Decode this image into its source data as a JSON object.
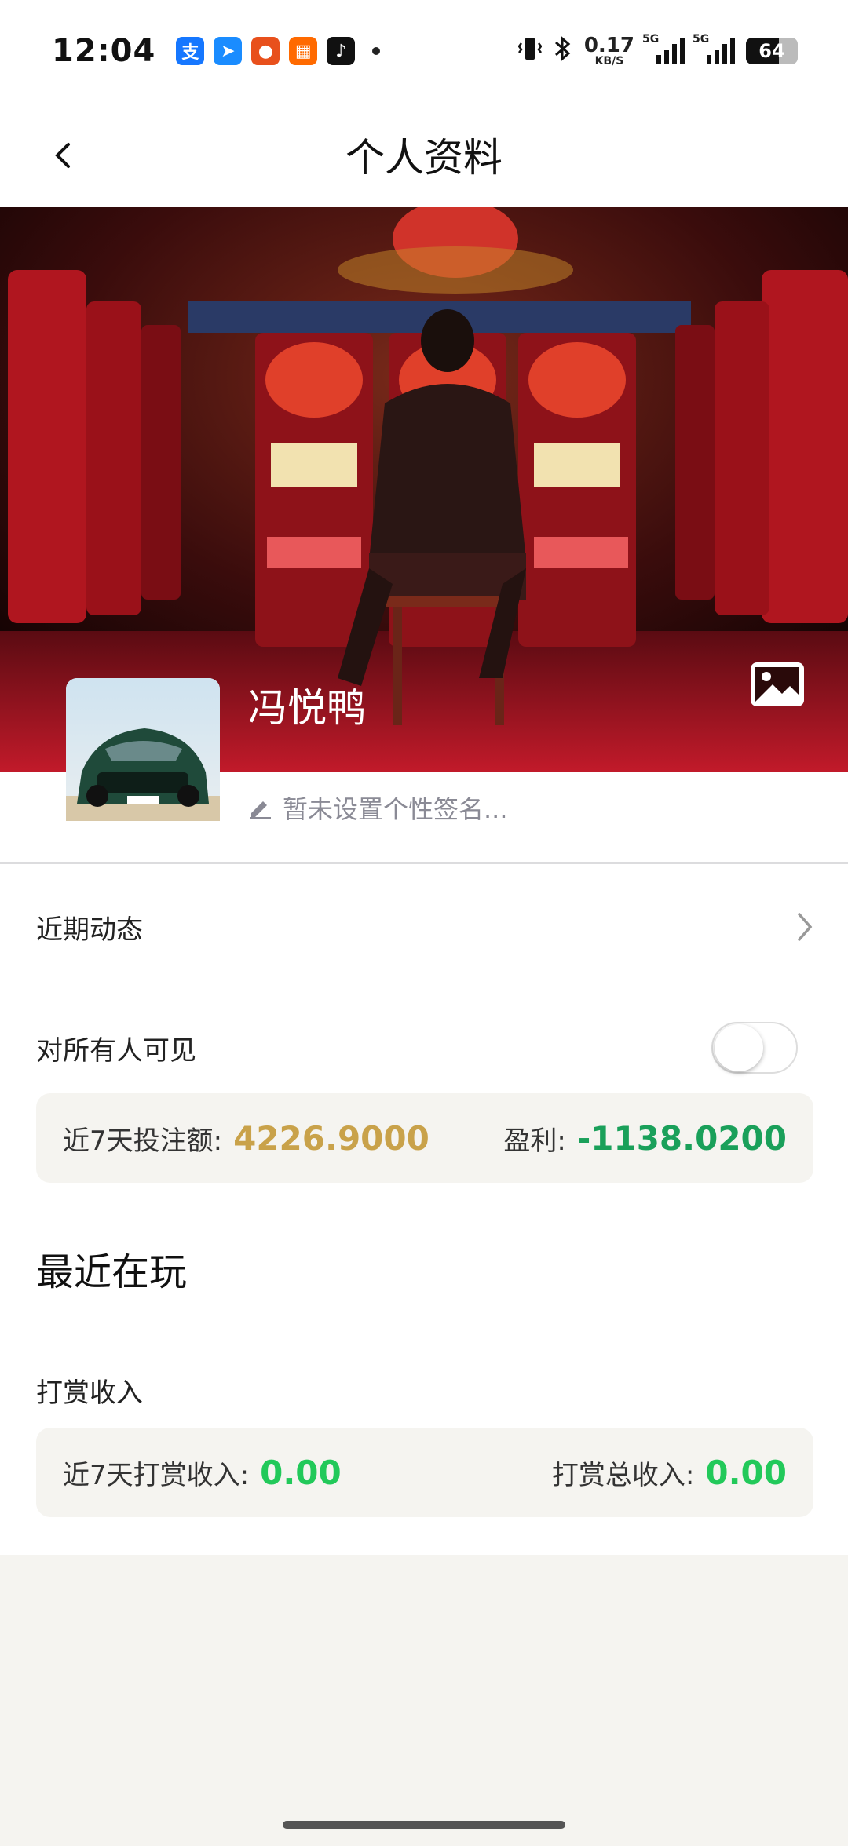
{
  "status_bar": {
    "time": "12:04",
    "apps": [
      {
        "icon": "alipay-icon",
        "glyph": "支",
        "color": "#1677ff"
      },
      {
        "icon": "paper-plane-app-icon",
        "glyph": "➤",
        "color": "#1a8cff"
      },
      {
        "icon": "orange-app-icon",
        "glyph": "●",
        "color": "#e8501c"
      },
      {
        "icon": "grid-app-icon",
        "glyph": "▦",
        "color": "#ff6a00"
      },
      {
        "icon": "tiktok-icon",
        "glyph": "♪",
        "color": "#111111"
      }
    ],
    "net_speed_value": "0.17",
    "net_speed_unit": "KB/S",
    "signal1_label": "5G",
    "signal2_label": "5G",
    "battery": "64",
    "battery_level": 0.64
  },
  "header": {
    "title": "个人资料"
  },
  "profile": {
    "nickname": "冯悦鸭",
    "signature_placeholder": "暂未设置个性签名..."
  },
  "recent_activity": {
    "label": "近期动态"
  },
  "visibility": {
    "label": "对所有人可见",
    "enabled": false
  },
  "betting_card": {
    "bet_label": "近7天投注额:",
    "bet_value": "4226.9000",
    "profit_label": "盈利:",
    "profit_value": "-1138.0200"
  },
  "recently_playing": {
    "title": "最近在玩"
  },
  "tips": {
    "title": "打赏收入",
    "week_label": "近7天打赏收入:",
    "week_value": "0.00",
    "total_label": "打赏总收入:",
    "total_value": "0.00"
  },
  "colors": {
    "bet_value": "#c9a24a",
    "profit_value": "#1aa05a",
    "tips_value": "#22c95a",
    "card_bg": "#f5f4f0"
  }
}
